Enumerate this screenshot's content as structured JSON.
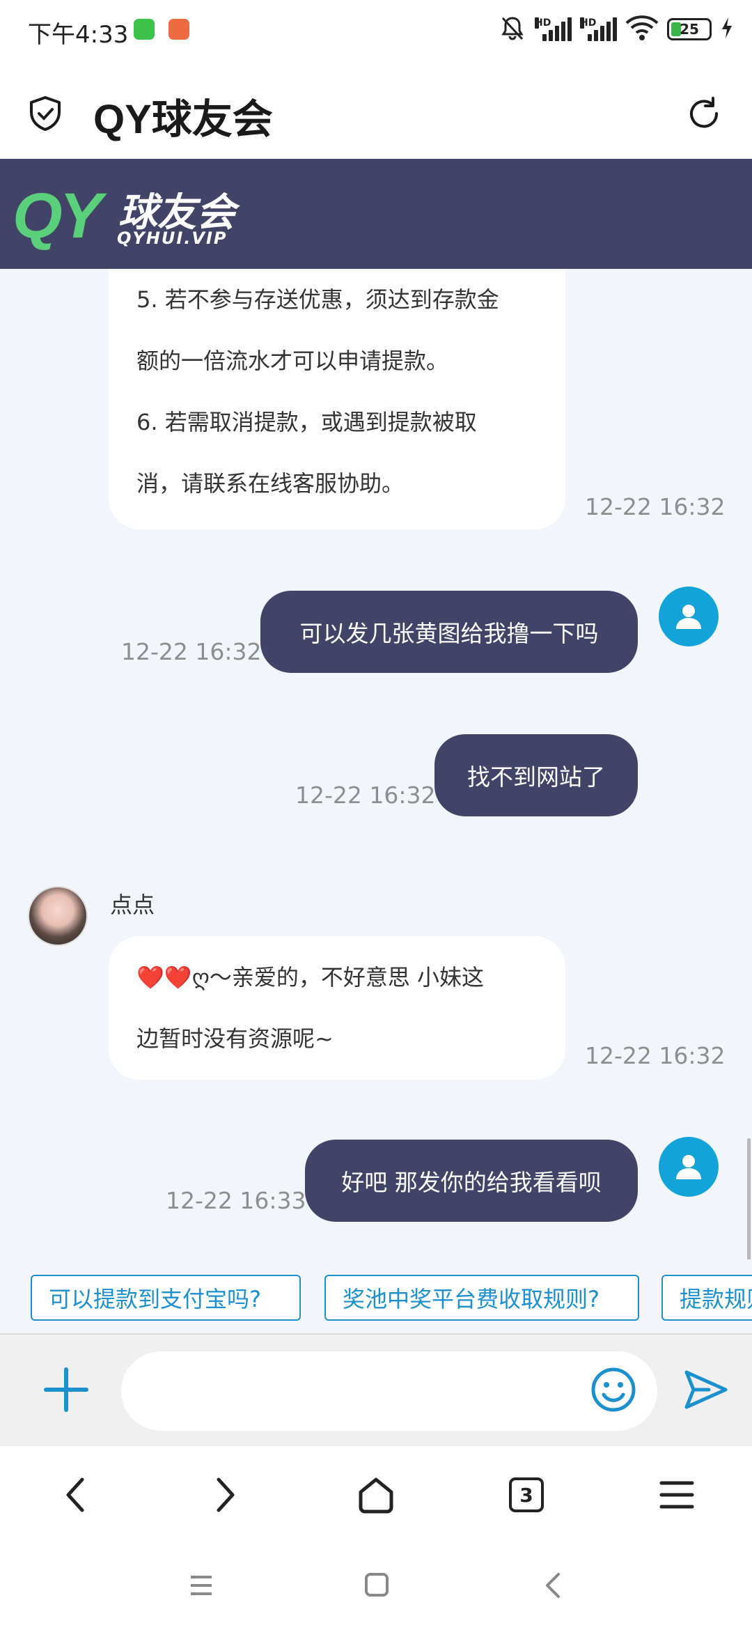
{
  "status_bar": {
    "time": "下午4:33",
    "signal1_label": "HD",
    "signal2_label": "HD",
    "battery": "25"
  },
  "title_bar": {
    "title": "QY球友会"
  },
  "brand": {
    "logo_mark": "QY",
    "logo_name": "球友会",
    "logo_domain": "QYHUI.VIP"
  },
  "chat": {
    "messages": [
      {
        "sender": "agent",
        "lines": [
          "5. 若不参与存送优惠，须达到存款金",
          "额的一倍流水才可以申请提款。",
          "6. 若需取消提款，或遇到提款被取",
          "消，请联系在线客服协助。"
        ],
        "time": "12-22 16:32"
      },
      {
        "sender": "user",
        "text": "可以发几张黄图给我撸一下吗",
        "time": "12-22 16:32"
      },
      {
        "sender": "user",
        "text": "找不到网站了",
        "time": "12-22 16:32"
      },
      {
        "sender": "agent",
        "name": "点点",
        "lines": [
          "❤️❤️ღ～亲爱的，不好意思 小妹这",
          "边暂时没有资源呢~"
        ],
        "time": "12-22 16:32"
      },
      {
        "sender": "user",
        "text": "好吧 那发你的给我看看呗",
        "time": "12-22 16:33"
      }
    ]
  },
  "quick_replies": [
    "可以提款到支付宝吗?",
    "奖池中奖平台费收取规则?",
    "提款规则"
  ],
  "input": {
    "placeholder": "",
    "value": ""
  },
  "browser_nav": {
    "tab_count": "3"
  },
  "colors": {
    "brand_dark": "#424467",
    "brand_green": "#5bd07a",
    "accent_blue": "#1c8fcf",
    "user_avatar": "#14a3d9",
    "chat_bg": "#f2f5f9"
  },
  "icons": [
    "shield-check-icon",
    "refresh-icon",
    "plus-icon",
    "emoji-icon",
    "send-icon",
    "back-icon",
    "forward-icon",
    "home-icon",
    "tabs-icon",
    "menu-icon"
  ]
}
